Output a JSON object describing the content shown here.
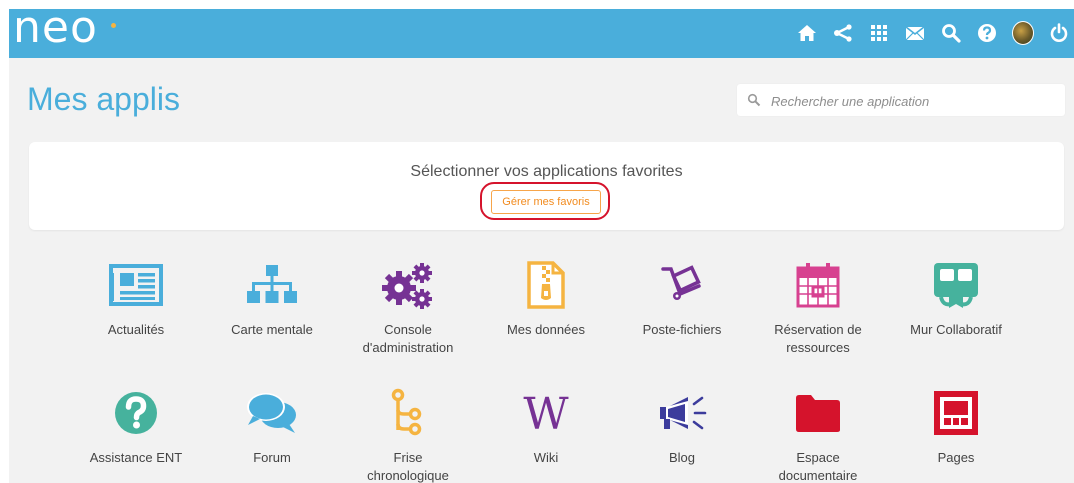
{
  "header": {
    "logo_text": "neo",
    "brand_color": "#4aaedb",
    "icons": [
      "home-icon",
      "share-icon",
      "apps-grid-icon",
      "mail-icon",
      "search-icon",
      "help-icon",
      "avatar",
      "power-icon"
    ]
  },
  "page": {
    "title": "Mes applis"
  },
  "search": {
    "placeholder": "Rechercher une application"
  },
  "favorites": {
    "prompt": "Sélectionner vos applications favorites",
    "button_label": "Gérer mes favoris",
    "highlight_color": "#d5132c"
  },
  "apps": [
    {
      "label": "Actualités",
      "icon": "newspaper-icon",
      "color": "#4aaedb"
    },
    {
      "label": "Carte mentale",
      "icon": "sitemap-icon",
      "color": "#4aaedb"
    },
    {
      "label": "Console\nd'administration",
      "icon": "cogs-icon",
      "color": "#763294"
    },
    {
      "label": "Mes données",
      "icon": "zip-file-icon",
      "color": "#f5b441"
    },
    {
      "label": "Poste-fichiers",
      "icon": "dolly-icon",
      "color": "#763294"
    },
    {
      "label": "Réservation de\nressources",
      "icon": "calendar-icon",
      "color": "#d74190"
    },
    {
      "label": "Mur Collaboratif",
      "icon": "whiteboard-icon",
      "color": "#46b29d"
    },
    {
      "label": "Assistance ENT",
      "icon": "question-circle-icon",
      "color": "#46b29d"
    },
    {
      "label": "Forum",
      "icon": "chat-bubbles-icon",
      "color": "#4aaedb"
    },
    {
      "label": "Frise\nchronologique",
      "icon": "timeline-icon",
      "color": "#f5b441"
    },
    {
      "label": "Wiki",
      "icon": "wiki-icon",
      "color": "#763294"
    },
    {
      "label": "Blog",
      "icon": "megaphone-icon",
      "color": "#3c3c9c"
    },
    {
      "label": "Espace\ndocumentaire",
      "icon": "folder-icon",
      "color": "#d5132c"
    },
    {
      "label": "Pages",
      "icon": "pages-icon",
      "color": "#d5132c"
    }
  ]
}
